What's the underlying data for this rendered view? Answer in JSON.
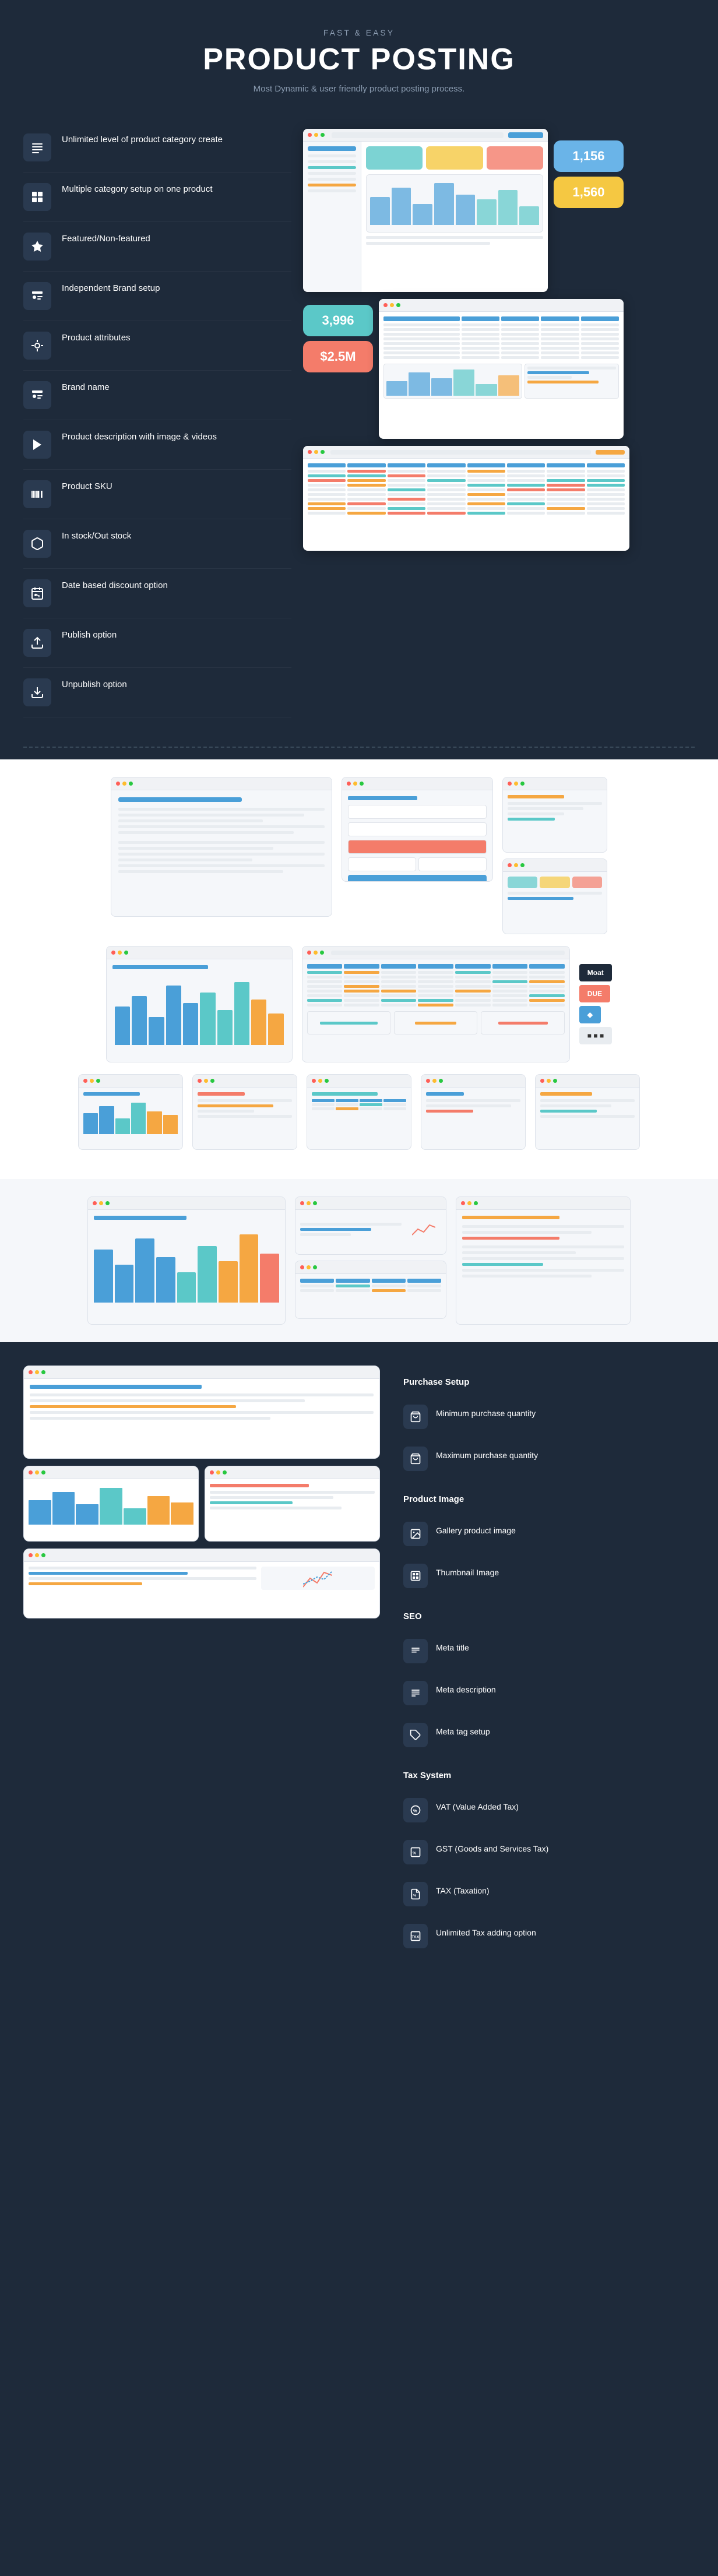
{
  "hero": {
    "eyebrow": "FAST & EASY",
    "title": "PRODUCT POSTING",
    "description": "Most Dynamic & user friendly product posting process."
  },
  "features": [
    {
      "id": "unlimited-category",
      "icon": "≡",
      "label": "Unlimited level of product category create"
    },
    {
      "id": "multiple-category",
      "icon": "⊞",
      "label": "Multiple category setup on one product"
    },
    {
      "id": "featured",
      "icon": "★",
      "label": "Featured/Non-featured"
    },
    {
      "id": "independent-brand",
      "icon": "◉",
      "label": "Independent Brand setup"
    },
    {
      "id": "product-attributes",
      "icon": "↺",
      "label": "Product attributes"
    },
    {
      "id": "brand-name",
      "icon": "◉",
      "label": "Brand name"
    },
    {
      "id": "product-description",
      "icon": "▶",
      "label": "Product description with image & videos"
    },
    {
      "id": "product-sku",
      "icon": "▦",
      "label": "Product SKU"
    },
    {
      "id": "in-stock",
      "icon": "📦",
      "label": "In stock/Out stock"
    },
    {
      "id": "date-discount",
      "icon": "📅",
      "label": "Date based discount option"
    },
    {
      "id": "publish",
      "icon": "↑",
      "label": "Publish option"
    },
    {
      "id": "unpublish",
      "icon": "↓",
      "label": "Unpublish option"
    }
  ],
  "cards": [
    {
      "value": "1,156",
      "color": "#6ab4e8",
      "label": "1,156"
    },
    {
      "value": "1,560",
      "color": "#f5c842",
      "label": "1,560"
    },
    {
      "value": "3,996",
      "color": "#5bc8c8",
      "label": "3,996"
    },
    {
      "value": "$2.5M",
      "color": "#f47c6a",
      "label": "$2.5M"
    }
  ],
  "purchase_setup": {
    "title": "Purchase Setup",
    "items": [
      {
        "icon": "📦",
        "label": "Minimum purchase quantity"
      },
      {
        "icon": "📦",
        "label": "Maximum purchase quantity"
      }
    ]
  },
  "product_image": {
    "title": "Product Image",
    "items": [
      {
        "icon": "🖼",
        "label": "Gallery product image"
      },
      {
        "icon": "🖼",
        "label": "Thumbnail Image"
      }
    ]
  },
  "seo": {
    "title": "SEO",
    "items": [
      {
        "icon": "≡",
        "label": "Meta title"
      },
      {
        "icon": "≡",
        "label": "Meta description"
      },
      {
        "icon": "≡",
        "label": "Meta tag setup"
      }
    ]
  },
  "tax_system": {
    "title": "Tax System",
    "items": [
      {
        "icon": "%",
        "label": "VAT (Value Added Tax)"
      },
      {
        "icon": "%",
        "label": "GST (Goods and Services Tax)"
      },
      {
        "icon": "%",
        "label": "TAX (Taxation)"
      },
      {
        "icon": "%",
        "label": "Unlimited Tax adding option"
      }
    ]
  },
  "brand_logos": [
    "Moat",
    "DUE",
    ""
  ],
  "screenshot_colors": {
    "teal": "#5bc8c8",
    "yellow": "#f5c842",
    "coral": "#f47c6a",
    "blue": "#4a9fd8",
    "green": "#5bc880",
    "purple": "#a06cd8"
  }
}
